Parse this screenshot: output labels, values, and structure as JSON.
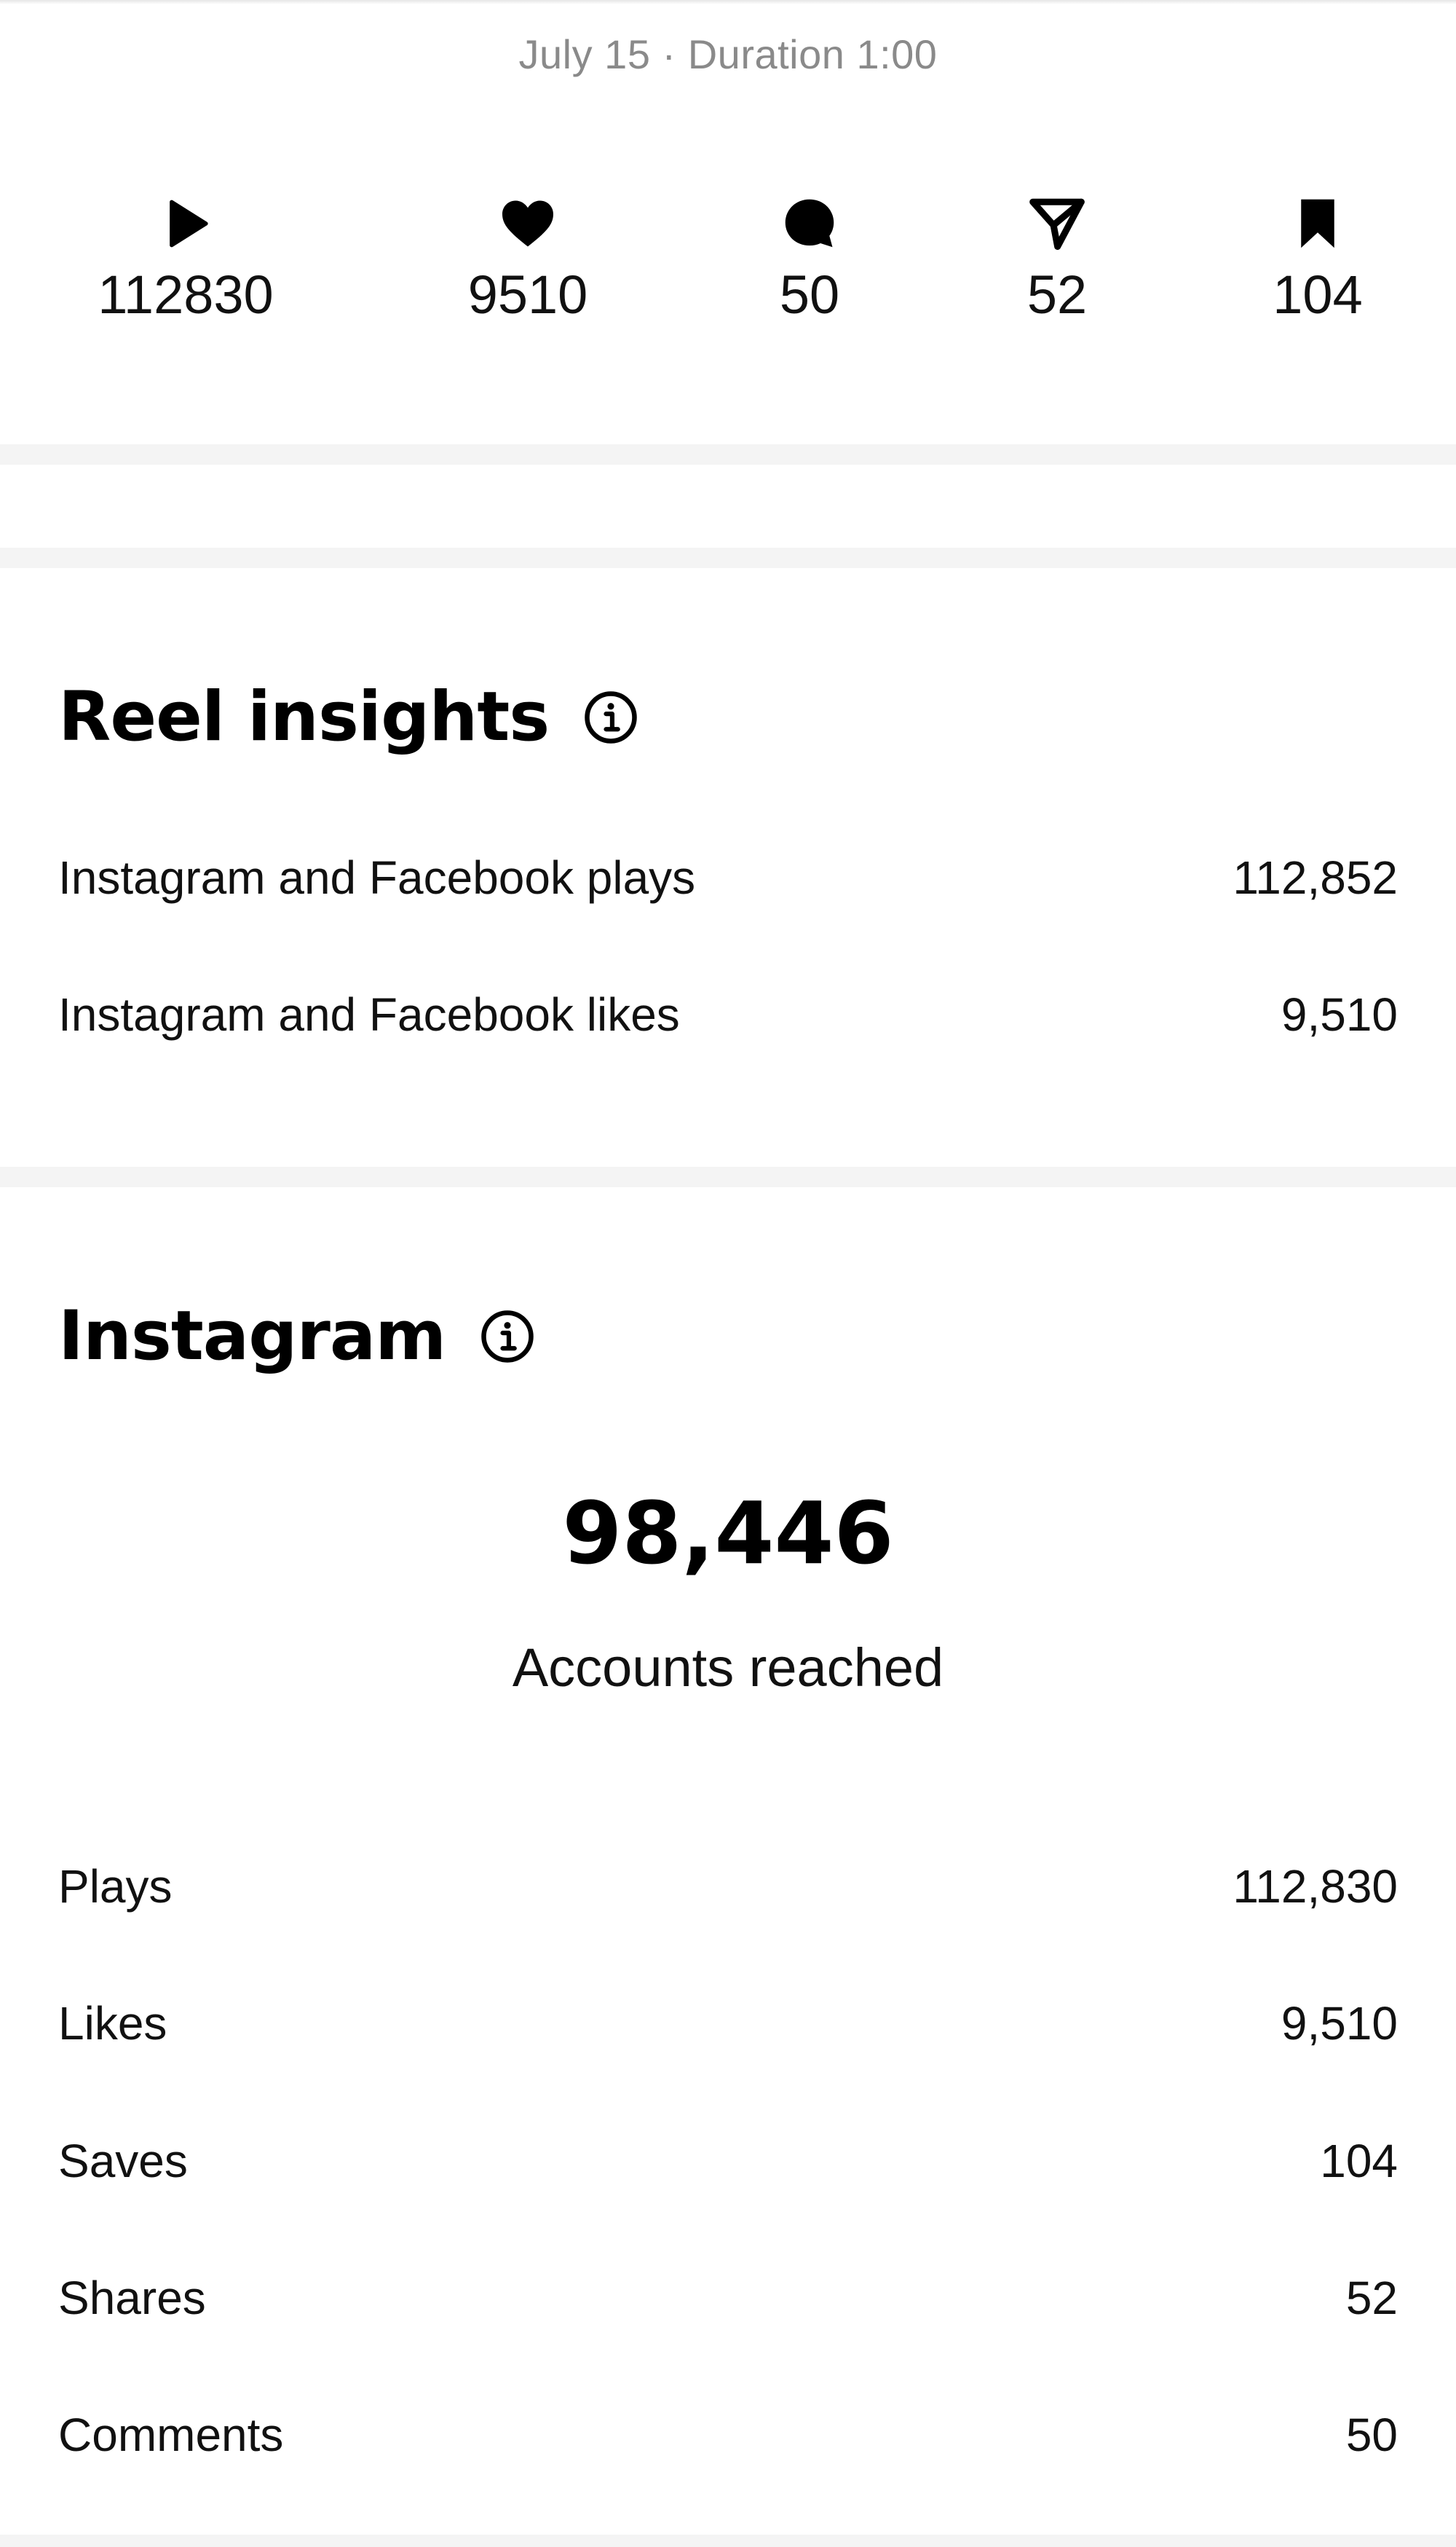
{
  "header": {
    "date_line": "July 15 · Duration 1:00"
  },
  "stats": [
    {
      "icon": "play-icon",
      "value": "112830"
    },
    {
      "icon": "heart-icon",
      "value": "9510"
    },
    {
      "icon": "comment-icon",
      "value": "50"
    },
    {
      "icon": "share-icon",
      "value": "52"
    },
    {
      "icon": "bookmark-icon",
      "value": "104"
    }
  ],
  "reel_insights": {
    "title": "Reel insights",
    "rows": [
      {
        "label": "Instagram and Facebook plays",
        "value": "112,852"
      },
      {
        "label": "Instagram and Facebook likes",
        "value": "9,510"
      }
    ]
  },
  "instagram": {
    "title": "Instagram",
    "reach_value": "98,446",
    "reach_label": "Accounts reached",
    "rows": [
      {
        "label": "Plays",
        "value": "112,830"
      },
      {
        "label": "Likes",
        "value": "9,510"
      },
      {
        "label": "Saves",
        "value": "104"
      },
      {
        "label": "Shares",
        "value": "52"
      },
      {
        "label": "Comments",
        "value": "50"
      }
    ]
  },
  "colors": {
    "text_primary": "#0f0f0f",
    "text_secondary": "#8a8a8a",
    "divider": "#f4f4f4",
    "background": "#ffffff"
  }
}
